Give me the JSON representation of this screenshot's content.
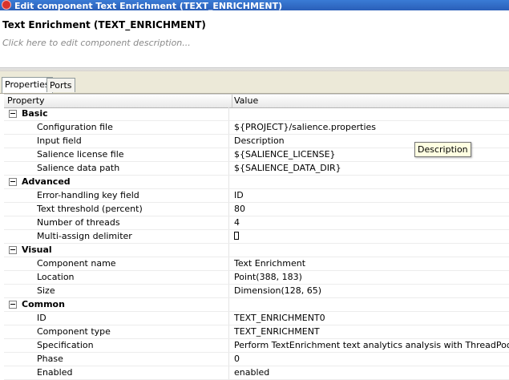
{
  "window": {
    "title": "Edit component Text Enrichment (TEXT_ENRICHMENT)"
  },
  "header": {
    "component_title": "Text Enrichment (TEXT_ENRICHMENT)",
    "description_placeholder": "Click here to edit component description..."
  },
  "tabs": [
    {
      "label": "Properties",
      "active": true
    },
    {
      "label": "Ports",
      "active": false
    }
  ],
  "table": {
    "columns": [
      "Property",
      "Value"
    ],
    "sections": [
      {
        "label": "Basic",
        "rows": [
          {
            "property": "Configuration file",
            "value": "${PROJECT}/salience.properties"
          },
          {
            "property": "Input field",
            "value": "Description"
          },
          {
            "property": "Salience license file",
            "value": "${SALIENCE_LICENSE}"
          },
          {
            "property": "Salience data path",
            "value": "${SALIENCE_DATA_DIR}"
          }
        ]
      },
      {
        "label": "Advanced",
        "rows": [
          {
            "property": "Error-handling key field",
            "value": "ID"
          },
          {
            "property": "Text threshold (percent)",
            "value": "80"
          },
          {
            "property": "Number of threads",
            "value": "4"
          },
          {
            "property": "Multi-assign delimiter",
            "value": ""
          }
        ]
      },
      {
        "label": "Visual",
        "rows": [
          {
            "property": "Component name",
            "value": "Text Enrichment"
          },
          {
            "property": "Location",
            "value": "Point(388, 183)"
          },
          {
            "property": "Size",
            "value": "Dimension(128, 65)"
          }
        ]
      },
      {
        "label": "Common",
        "rows": [
          {
            "property": "ID",
            "value": "TEXT_ENRICHMENT0"
          },
          {
            "property": "Component type",
            "value": "TEXT_ENRICHMENT"
          },
          {
            "property": "Specification",
            "value": "Perform TextEnrichment text analytics analysis with ThreadPools."
          },
          {
            "property": "Phase",
            "value": "0"
          },
          {
            "property": "Enabled",
            "value": "enabled"
          }
        ]
      }
    ]
  },
  "tooltip": {
    "text": "Description"
  }
}
